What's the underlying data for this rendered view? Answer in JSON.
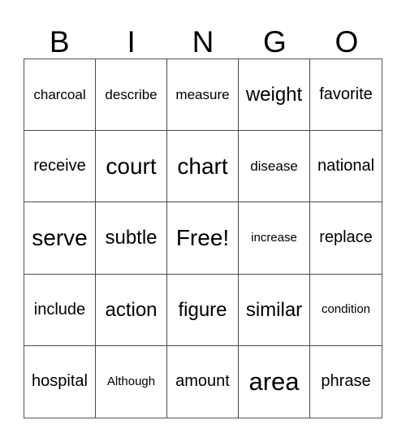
{
  "card": {
    "title": "BINGO",
    "header_letters": [
      "B",
      "I",
      "N",
      "G",
      "O"
    ],
    "free_space_label": "Free!",
    "background_color": "#ffffff",
    "text_color": "#000000",
    "border_color": "#4a4a4a",
    "rows": [
      [
        {
          "label": "charcoal",
          "size": "s-sm"
        },
        {
          "label": "describe",
          "size": "s-sm"
        },
        {
          "label": "measure",
          "size": "s-sm"
        },
        {
          "label": "weight",
          "size": "s-lg"
        },
        {
          "label": "favorite",
          "size": "s-md"
        }
      ],
      [
        {
          "label": "receive",
          "size": "s-md"
        },
        {
          "label": "court",
          "size": "s-xl"
        },
        {
          "label": "chart",
          "size": "s-xl"
        },
        {
          "label": "disease",
          "size": "s-sm"
        },
        {
          "label": "national",
          "size": "s-md"
        }
      ],
      [
        {
          "label": "serve",
          "size": "s-xl"
        },
        {
          "label": "subtle",
          "size": "s-lg"
        },
        {
          "label": "Free!",
          "size": "s-xl"
        },
        {
          "label": "increase",
          "size": "s-xs"
        },
        {
          "label": "replace",
          "size": "s-md"
        }
      ],
      [
        {
          "label": "include",
          "size": "s-md"
        },
        {
          "label": "action",
          "size": "s-lg"
        },
        {
          "label": "figure",
          "size": "s-lg"
        },
        {
          "label": "similar",
          "size": "s-lg"
        },
        {
          "label": "condition",
          "size": "s-xs"
        }
      ],
      [
        {
          "label": "hospital",
          "size": "s-md"
        },
        {
          "label": "Although",
          "size": "s-xs"
        },
        {
          "label": "amount",
          "size": "s-md"
        },
        {
          "label": "area",
          "size": "s-xxl"
        },
        {
          "label": "phrase",
          "size": "s-md"
        }
      ]
    ]
  }
}
